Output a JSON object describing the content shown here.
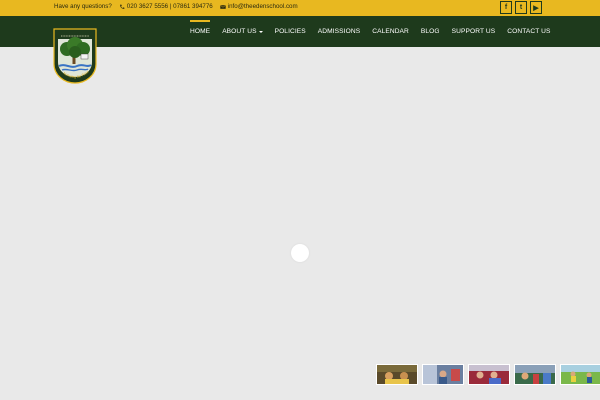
{
  "topbar": {
    "question": "Have any questions?",
    "phone": "020 3627 5556 | 07861 394776",
    "email": "info@theedenschool.com",
    "social_icons": [
      "facebook-icon",
      "twitter-icon",
      "youtube-icon"
    ],
    "social_glyphs": [
      "f",
      "t",
      "▶"
    ]
  },
  "nav": {
    "items": [
      "HOME",
      "ABOUT US",
      "POLICIES",
      "ADMISSIONS",
      "CALENDAR",
      "BLOG",
      "SUPPORT US",
      "CONTACT US"
    ],
    "active": "HOME"
  },
  "crest": {
    "motto": "Nurturing the Future"
  },
  "colors": {
    "brand_yellow": "#e8b820",
    "brand_green": "#1e3a1c",
    "background": "#e9e9e9"
  },
  "slider": {
    "thumbnails": [
      "thumbnail-1",
      "thumbnail-2",
      "thumbnail-3",
      "thumbnail-4",
      "thumbnail-5"
    ]
  }
}
